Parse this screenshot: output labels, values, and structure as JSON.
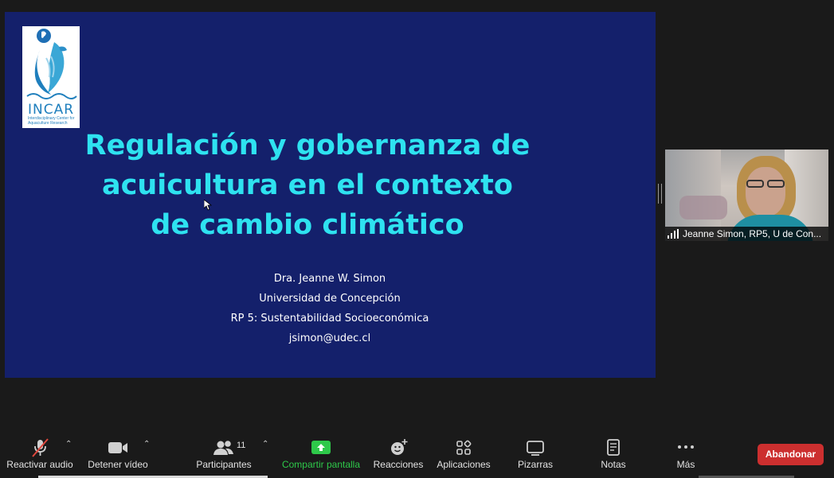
{
  "slide": {
    "logo": {
      "name": "INCAR",
      "tagline": "Interdisciplinary Center for Aquaculture Research"
    },
    "title_lines": [
      "Regulación y gobernanza de",
      "acuicultura en el contexto",
      "de cambio climático"
    ],
    "author_lines": [
      "Dra. Jeanne W. Simon",
      "Universidad de Concepción",
      "RP 5: Sustentabilidad Socioeconómica",
      "jsimon@udec.cl"
    ],
    "background_color": "#14206b",
    "title_color": "#2ee2f0"
  },
  "video": {
    "participant_name": "Jeanne Simon, RP5, U de Con..."
  },
  "toolbar": {
    "audio_label": "Reactivar audio",
    "video_label": "Detener vídeo",
    "participants_label": "Participantes",
    "participants_count": "11",
    "share_label": "Compartir pantalla",
    "reactions_label": "Reacciones",
    "apps_label": "Aplicaciones",
    "whiteboards_label": "Pizarras",
    "notes_label": "Notas",
    "more_label": "Más",
    "leave_label": "Abandonar",
    "share_color": "#2ec94a",
    "leave_color": "#cc2f2f"
  }
}
